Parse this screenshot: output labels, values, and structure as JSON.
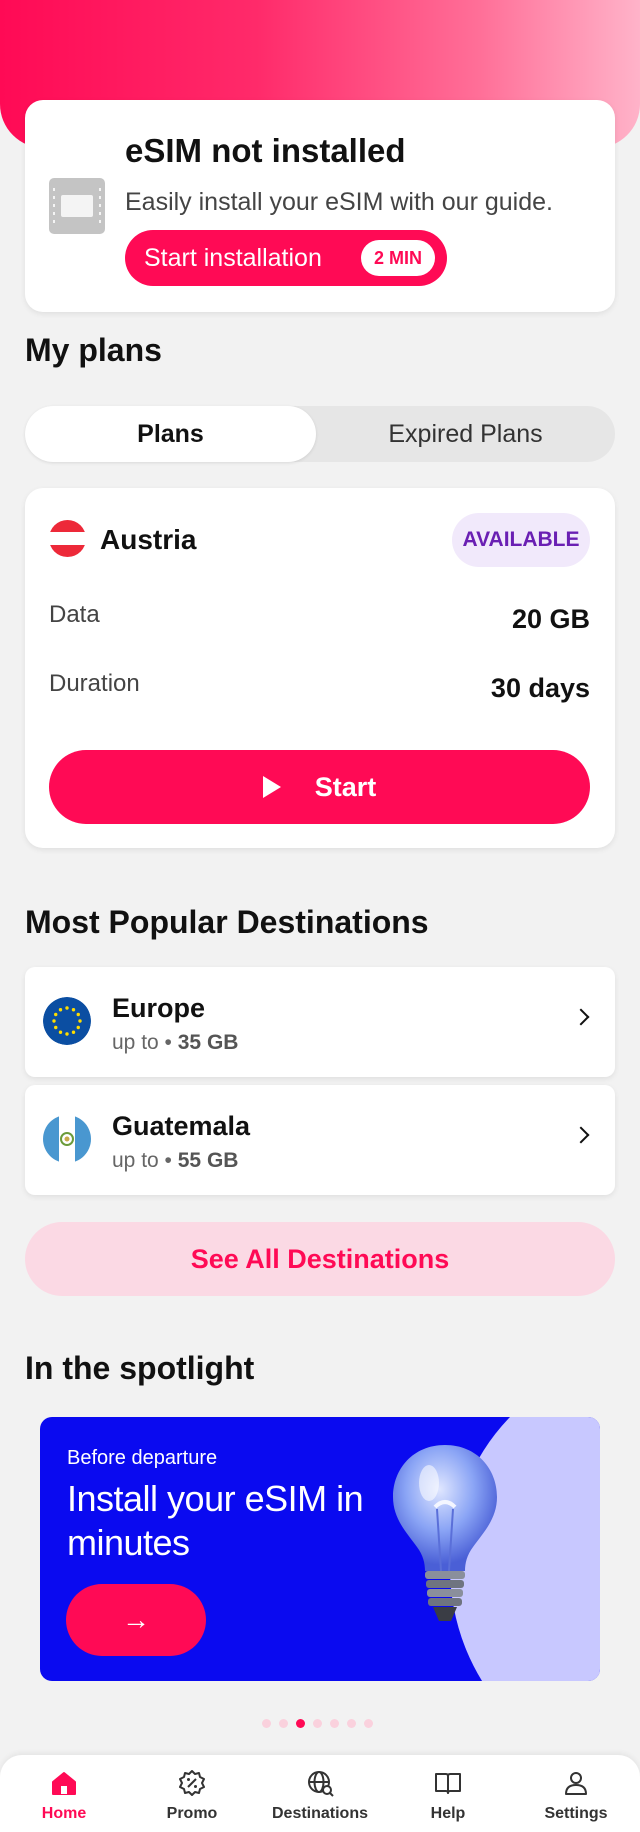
{
  "colors": {
    "brand": "#ff0a55",
    "available_badge_bg": "#f1e9fb",
    "available_badge_text": "#6a1fb3",
    "see_all_bg": "#fbd9e4",
    "banner_bg": "#0a0af0"
  },
  "esim_card": {
    "title": "eSIM not installed",
    "subtitle": "Easily install your eSIM with our guide.",
    "button_label": "Start installation",
    "button_badge": "2 MIN",
    "icon": "sim-card-icon"
  },
  "my_plans": {
    "title": "My plans",
    "tabs": [
      {
        "label": "Plans",
        "active": true
      },
      {
        "label": "Expired Plans",
        "active": false
      }
    ],
    "plan": {
      "country": "Austria",
      "flag": "austria-flag-icon",
      "status": "AVAILABLE",
      "data_label": "Data",
      "data_value": "20 GB",
      "duration_label": "Duration",
      "duration_value": "30 days",
      "start_label": "Start"
    }
  },
  "popular": {
    "title": "Most Popular Destinations",
    "items": [
      {
        "name": "Europe",
        "prefix": "up to •",
        "amount": "35 GB",
        "flag": "eu-flag-icon"
      },
      {
        "name": "Guatemala",
        "prefix": "up to •",
        "amount": "55 GB",
        "flag": "guatemala-flag-icon"
      }
    ],
    "see_all_label": "See All Destinations"
  },
  "spotlight": {
    "title": "In the spotlight",
    "banner": {
      "kicker": "Before departure",
      "headline": "Install your eSIM in minutes",
      "button_glyph": "→"
    },
    "pager": {
      "count": 7,
      "active_index": 2
    }
  },
  "bottom_nav": {
    "items": [
      {
        "label": "Home",
        "icon": "home-icon",
        "active": true
      },
      {
        "label": "Promo",
        "icon": "promo-icon",
        "active": false
      },
      {
        "label": "Destinations",
        "icon": "globe-search-icon",
        "active": false
      },
      {
        "label": "Help",
        "icon": "book-icon",
        "active": false
      },
      {
        "label": "Settings",
        "icon": "user-icon",
        "active": false
      }
    ]
  }
}
